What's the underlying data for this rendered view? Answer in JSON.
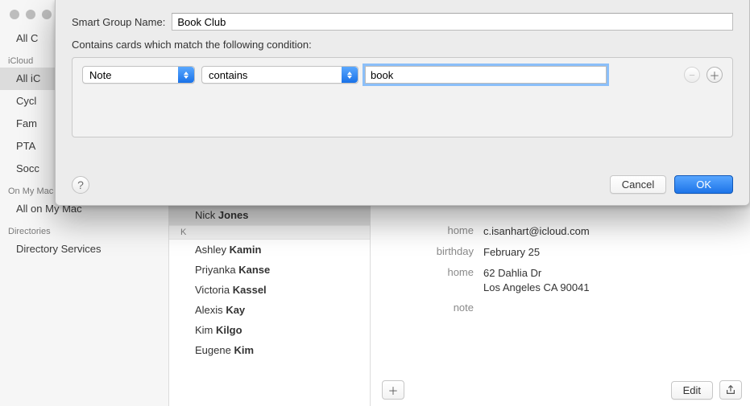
{
  "sidebar": {
    "items_top": [
      {
        "label": "All C"
      }
    ],
    "groups": [
      {
        "header": "iCloud",
        "items": [
          "All iC",
          "Cycl",
          "Fam",
          "PTA",
          "Socc"
        ],
        "selected_index": 0
      },
      {
        "header": "On My Mac",
        "items": [
          "All on My Mac"
        ]
      },
      {
        "header": "Directories",
        "items": [
          "Directory Services"
        ]
      }
    ]
  },
  "contacts": {
    "visible": [
      {
        "type": "row",
        "first": "Nick",
        "last": "Jones",
        "selected": true
      },
      {
        "type": "separator",
        "letter": "K"
      },
      {
        "type": "row",
        "first": "Ashley",
        "last": "Kamin"
      },
      {
        "type": "row",
        "first": "Priyanka",
        "last": "Kanse"
      },
      {
        "type": "row",
        "first": "Victoria",
        "last": "Kassel"
      },
      {
        "type": "row",
        "first": "Alexis",
        "last": "Kay"
      },
      {
        "type": "row",
        "first": "Kim",
        "last": "Kilgo"
      },
      {
        "type": "row",
        "first": "Eugene",
        "last": "Kim"
      }
    ]
  },
  "detail": {
    "fields": [
      {
        "label": "home",
        "value": "c.isanhart@icloud.com"
      },
      {
        "label": "birthday",
        "value": "February 25"
      },
      {
        "label": "home",
        "value": "62 Dahlia Dr\nLos Angeles CA 90041"
      },
      {
        "label": "note",
        "value": ""
      }
    ],
    "buttons": {
      "edit": "Edit"
    }
  },
  "sheet": {
    "name_label": "Smart Group Name:",
    "name_value": "Book Club",
    "instruction": "Contains cards which match the following condition:",
    "rule": {
      "field": "Note",
      "operator": "contains",
      "value": "book"
    },
    "buttons": {
      "cancel": "Cancel",
      "ok": "OK"
    }
  }
}
